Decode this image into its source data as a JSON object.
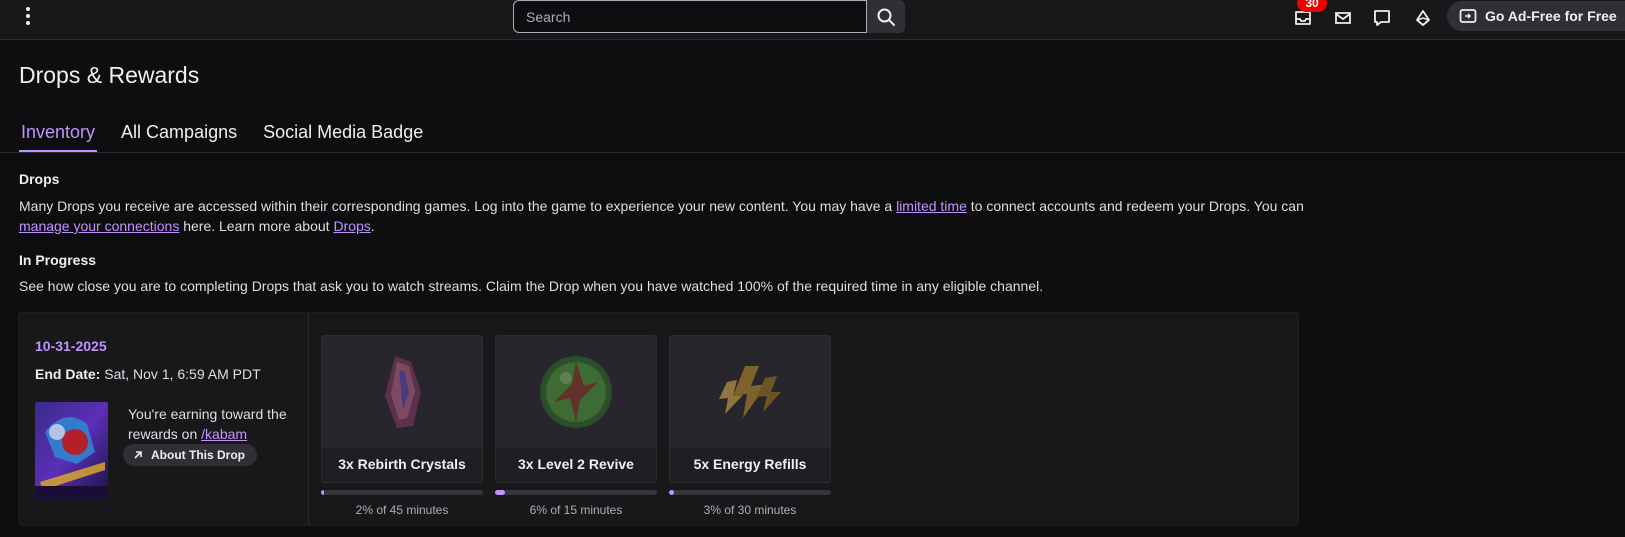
{
  "topnav": {
    "search_placeholder": "Search",
    "notification_count": "30",
    "ad_free_label": "Go Ad-Free for Free"
  },
  "page": {
    "title": "Drops & Rewards",
    "tabs": [
      {
        "label": "Inventory",
        "active": true
      },
      {
        "label": "All Campaigns",
        "active": false
      },
      {
        "label": "Social Media Badge",
        "active": false
      }
    ]
  },
  "drops_section": {
    "heading": "Drops",
    "text_1": "Many Drops you receive are accessed within their corresponding games. Log into the game to experience your new content. You may have a ",
    "link_limited_time": "limited time",
    "text_2": " to connect accounts and redeem your Drops. You can ",
    "link_manage": "manage your connections",
    "text_3": " here. Learn more about ",
    "link_drops": "Drops",
    "text_4": "."
  },
  "in_progress": {
    "heading": "In Progress",
    "text": "See how close you are to completing Drops that ask you to watch streams. Claim the Drop when you have watched 100% of the required time in any eligible channel."
  },
  "campaign": {
    "date": "10-31-2025",
    "end_label": "End Date:",
    "end_value": " Sat, Nov 1, 6:59 AM PDT",
    "earning_text": "You're earning toward the rewards on ",
    "channel_link": "/kabam",
    "about_label": "About This Drop",
    "rewards": [
      {
        "name": "3x Rebirth Crystals",
        "progress_text": "2% of 45 minutes",
        "progress": 0.02
      },
      {
        "name": "3x Level 2 Revive",
        "progress_text": "6% of 15 minutes",
        "progress": 0.06
      },
      {
        "name": "5x Energy Refills",
        "progress_text": "3% of 30 minutes",
        "progress": 0.03
      }
    ]
  },
  "colors": {
    "accent": "#bf94ff",
    "background": "#0e0e10",
    "surface": "#18181b",
    "badge": "#eb0400"
  }
}
